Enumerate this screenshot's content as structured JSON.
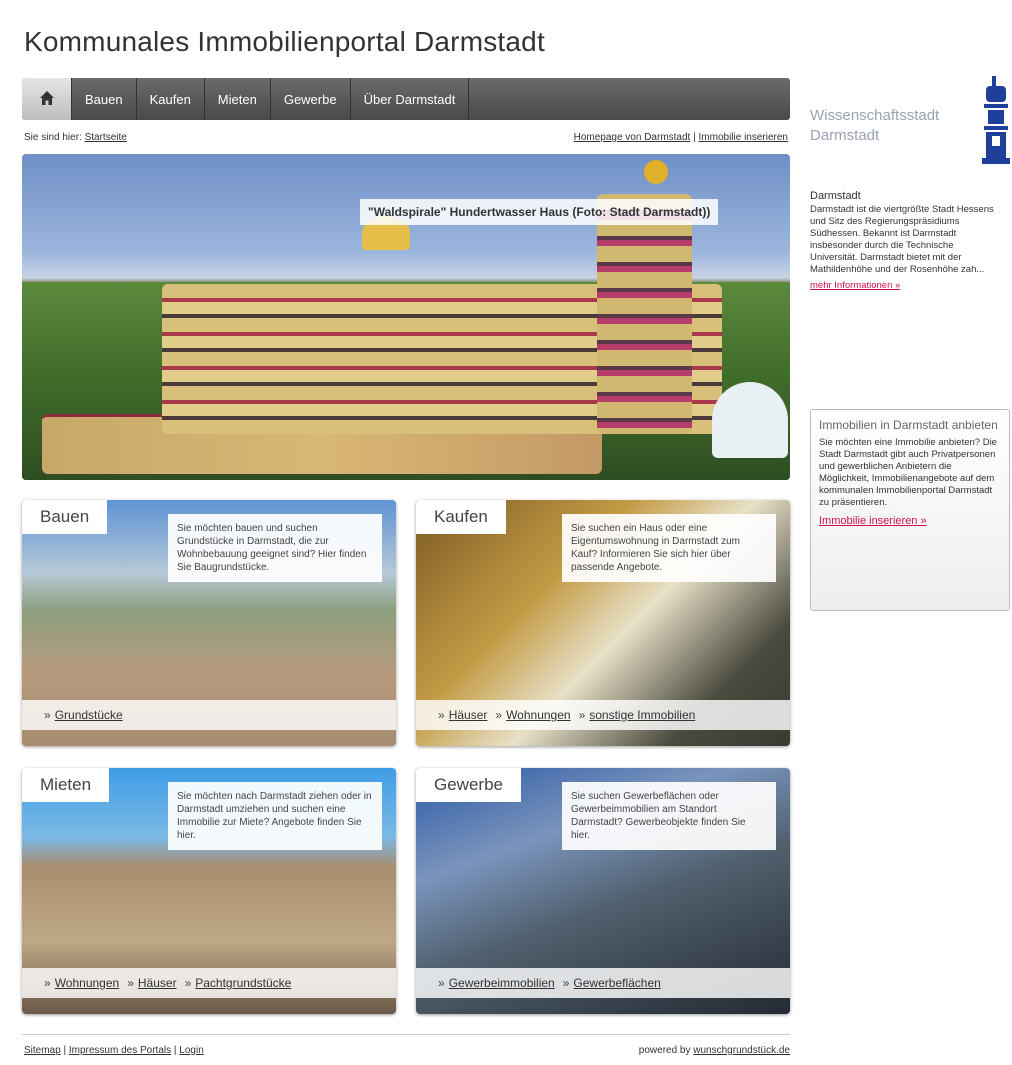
{
  "header": {
    "title": "Kommunales Immobilienportal Darmstadt"
  },
  "nav": {
    "home_icon": "home-icon",
    "items": [
      "Bauen",
      "Kaufen",
      "Mieten",
      "Gewerbe",
      "Über Darmstadt"
    ]
  },
  "breadcrumb": {
    "prefix": "Sie sind hier:",
    "current": "Startseite"
  },
  "top_links": {
    "homepage": "Homepage von Darmstadt",
    "separator": "|",
    "insert": "Immobilie inserieren"
  },
  "hero": {
    "caption": "\"Waldspirale\" Hundertwasser Haus (Foto: Stadt Darmstadt))"
  },
  "boxes": {
    "bauen": {
      "title": "Bauen",
      "desc": "Sie möchten bauen und suchen Grundstücke in Darmstadt, die zur Wohnbebauung geeignet sind? Hier finden Sie Baugrundstücke.",
      "links": [
        "Grundstücke"
      ]
    },
    "kaufen": {
      "title": "Kaufen",
      "desc": "Sie suchen ein Haus oder eine Eigentumswohnung in Darmstadt zum Kauf? Informieren Sie sich hier über passende Angebote.",
      "links": [
        "Häuser",
        "Wohnungen",
        "sonstige Immobilien"
      ]
    },
    "mieten": {
      "title": "Mieten",
      "desc": "Sie möchten nach Darmstadt ziehen oder in Darmstadt umziehen und suchen eine Immobilie zur Miete? Angebote finden Sie hier.",
      "links": [
        "Wohnungen",
        "Häuser",
        "Pachtgrundstücke"
      ]
    },
    "gewerbe": {
      "title": "Gewerbe",
      "desc": "Sie suchen Gewerbeflächen oder Gewerbeimmobilien am Standort Darmstadt? Gewerbeobjekte finden Sie hier.",
      "links": [
        "Gewerbeimmobilien",
        "Gewerbeflächen"
      ]
    }
  },
  "link_marker": "»",
  "footer": {
    "sitemap": "Sitemap",
    "impressum": "Impressum des Portals",
    "login": "Login",
    "separator": "|",
    "powered_prefix": "powered by",
    "powered_link": "wunschgrundstück.de"
  },
  "brand": {
    "line1": "Wissenschaftsstadt",
    "line2": "Darmstadt",
    "logo_icon": "darmstadt-logo-icon"
  },
  "sidebar_info": {
    "heading": "Darmstadt",
    "text": "Darmstadt ist die viertgrößte Stadt Hessens und Sitz des Regierungspräsidiums Südhessen. Bekannt ist Darmstadt insbesonder durch die Technische Universität. Darmstadt bietet mit der Mathildenhöhe und der Rosenhöhe zah...",
    "link": "mehr Informationen »"
  },
  "offer_box": {
    "heading": "Immobilien in Darmstadt anbieten",
    "text": "Sie möchten eine Immobilie anbieten? Die Stadt Darmstadt gibt auch Privatpersonen und gewerblichen Anbietern die Möglichkeit, Immobilienangebote auf dem kommunalen Immobilienportal Darmstadt zu präsentieren.",
    "link": "Immobilie inserieren »"
  },
  "colors": {
    "accent_link": "#d0104e",
    "nav_bg": "#555555",
    "brand_blue": "#1e3f9a"
  }
}
